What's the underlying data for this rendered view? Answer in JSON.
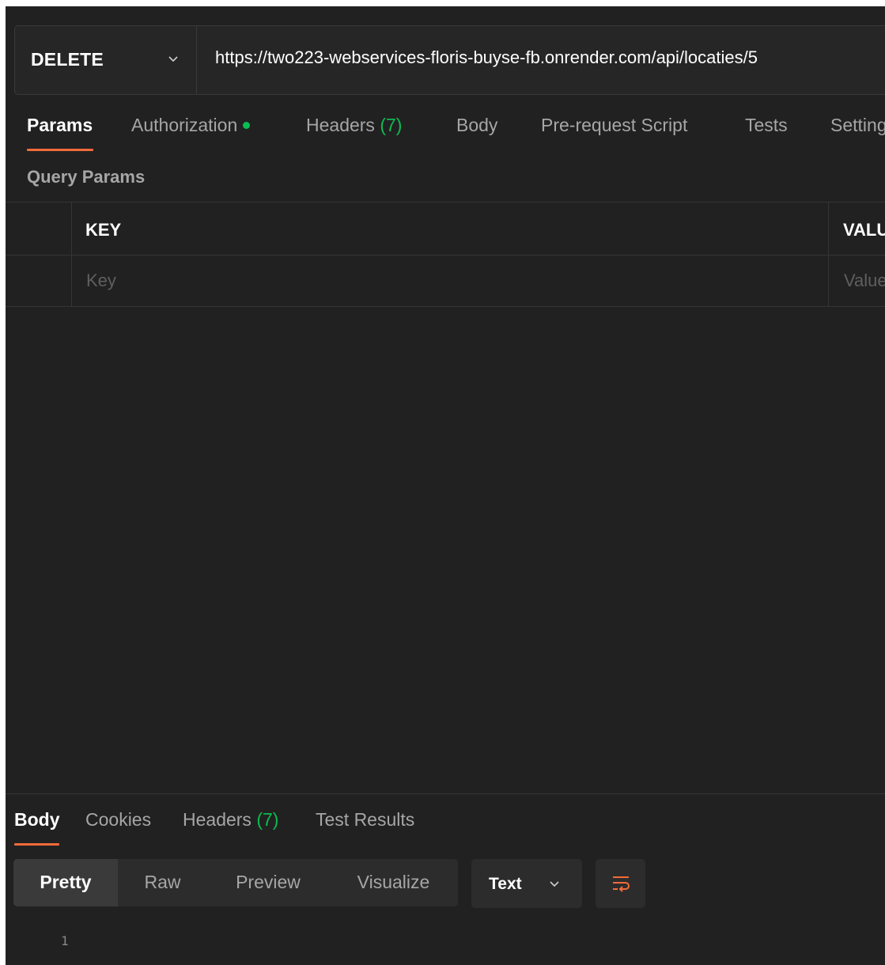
{
  "request": {
    "method": "DELETE",
    "url": "https://two223-webservices-floris-buyse-fb.onrender.com/api/locaties/5"
  },
  "tabs": {
    "params": "Params",
    "authorization": "Authorization",
    "headers": "Headers",
    "headers_count": "(7)",
    "body": "Body",
    "prerequest": "Pre-request Script",
    "tests": "Tests",
    "settings": "Settings"
  },
  "query_params": {
    "title": "Query Params",
    "columns": {
      "key": "KEY",
      "value": "VALUE"
    },
    "placeholders": {
      "key": "Key",
      "value": "Value"
    }
  },
  "response": {
    "tabs": {
      "body": "Body",
      "cookies": "Cookies",
      "headers": "Headers",
      "headers_count": "(7)",
      "test_results": "Test Results"
    },
    "views": {
      "pretty": "Pretty",
      "raw": "Raw",
      "preview": "Preview",
      "visualize": "Visualize"
    },
    "format": "Text",
    "line_number": "1"
  },
  "icons": {
    "method_dropdown": "chevron-down-icon",
    "auth_status": "status-dot-icon",
    "format_dropdown": "chevron-down-icon",
    "wrap": "wrap-lines-icon"
  },
  "colors": {
    "accent": "#f26b3a",
    "success": "#0cbb52",
    "background": "#212121"
  }
}
